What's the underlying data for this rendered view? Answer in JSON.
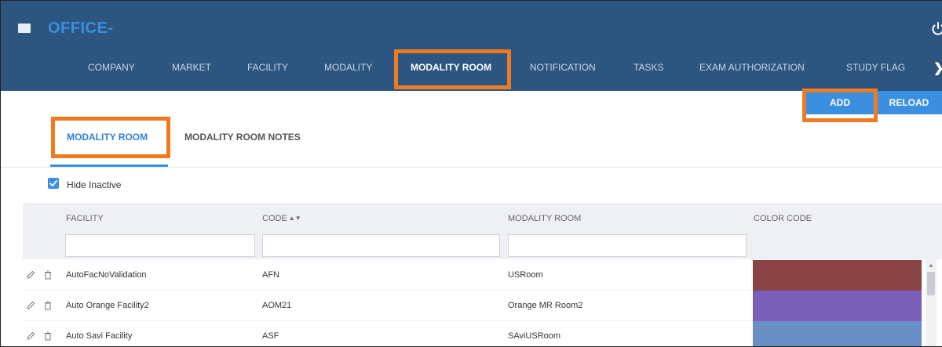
{
  "header": {
    "title": "OFFICE",
    "title_suffix": "-",
    "nav": [
      {
        "label": "COMPANY"
      },
      {
        "label": "MARKET"
      },
      {
        "label": "FACILITY"
      },
      {
        "label": "MODALITY"
      },
      {
        "label": "MODALITY ROOM",
        "active": true
      },
      {
        "label": "NOTIFICATION"
      },
      {
        "label": "TASKS"
      },
      {
        "label": "EXAM AUTHORIZATION"
      },
      {
        "label": "STUDY FLAG"
      }
    ],
    "next_arrow": "❯"
  },
  "toolbar": {
    "add_label": "ADD",
    "reload_label": "RELOAD"
  },
  "tabs": [
    {
      "label": "MODALITY ROOM",
      "active": true
    },
    {
      "label": "MODALITY ROOM NOTES",
      "active": false
    }
  ],
  "filter": {
    "hide_inactive_label": "Hide Inactive",
    "hide_inactive_checked": true
  },
  "grid": {
    "columns": [
      "FACILITY",
      "CODE",
      "MODALITY ROOM",
      "COLOR CODE"
    ],
    "sort_column": "CODE",
    "sort_indicator": "▲▼",
    "filter_values": [
      "",
      "",
      ""
    ],
    "rows": [
      {
        "facility": "AutoFacNoValidation",
        "code": "AFN",
        "room": "USRoom",
        "color": "#8b4445"
      },
      {
        "facility": "Auto Orange Facility2",
        "code": "AOM21",
        "room": "Orange MR Room2",
        "color": "#7a5fb8"
      },
      {
        "facility": "Auto Savi Facility",
        "code": "ASF",
        "room": "SAviUSRoom",
        "color": "#6a8fc7"
      }
    ]
  },
  "colors": {
    "header_bg": "#2c5680",
    "accent": "#3b8fe0",
    "highlight": "#f07a22"
  },
  "icons": {
    "menu": "hamburger-icon",
    "power": "power-icon",
    "edit": "pencil-icon",
    "delete": "trash-icon",
    "next": "chevron-right-icon"
  }
}
